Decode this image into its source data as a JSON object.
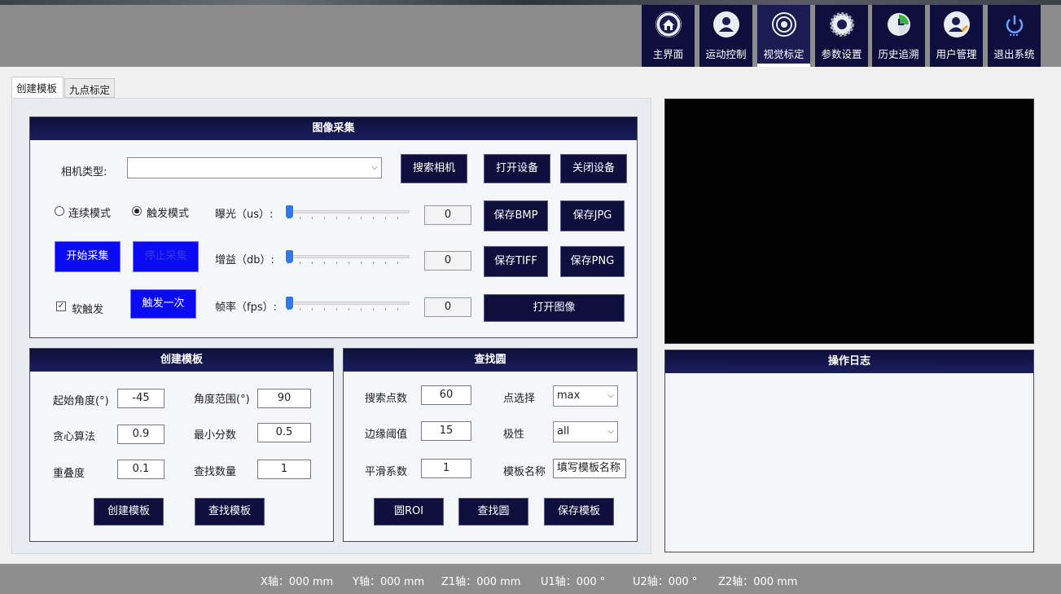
{
  "nav": {
    "items": [
      {
        "label": "主界面",
        "icon": "home-icon"
      },
      {
        "label": "运动控制",
        "icon": "user-icon"
      },
      {
        "label": "视觉标定",
        "icon": "target-icon"
      },
      {
        "label": "参数设置",
        "icon": "gear-icon"
      },
      {
        "label": "历史追溯",
        "icon": "history-icon"
      },
      {
        "label": "用户管理",
        "icon": "user-edit-icon"
      },
      {
        "label": "退出系统",
        "icon": "power-icon"
      }
    ],
    "active_index": 2
  },
  "tabs": [
    "创建模板",
    "九点标定"
  ],
  "capture": {
    "title": "图像采集",
    "camera_type_label": "相机类型:",
    "camera_type_value": "",
    "search_camera": "搜索相机",
    "open_device": "打开设备",
    "close_device": "关闭设备",
    "mode_continuous": "连续模式",
    "mode_trigger": "触发模式",
    "selected_mode": "trigger",
    "exposure_label": "曝光（us）:",
    "exposure_value": "0",
    "gain_label": "增益（db）:",
    "gain_value": "0",
    "fps_label": "帧率（fps）:",
    "fps_value": "0",
    "save_bmp": "保存BMP",
    "save_jpg": "保存JPG",
    "save_tiff": "保存TIFF",
    "save_png": "保存PNG",
    "start_capture": "开始采集",
    "stop_capture": "停止采集",
    "soft_trigger": "软触发",
    "soft_trigger_checked": true,
    "trigger_once": "触发一次",
    "open_image": "打开图像"
  },
  "create_template": {
    "title": "创建模板",
    "start_angle_label": "起始角度(°)",
    "start_angle_value": "-45",
    "angle_range_label": "角度范围(°)",
    "angle_range_value": "90",
    "greedy_label": "贪心算法",
    "greedy_value": "0.9",
    "min_score_label": "最小分数",
    "min_score_value": "0.5",
    "overlap_label": "重叠度",
    "overlap_value": "0.1",
    "find_count_label": "查找数量",
    "find_count_value": "1",
    "create_button": "创建模板",
    "find_button": "查找模板"
  },
  "find_circle": {
    "title": "查找圆",
    "search_points_label": "搜索点数",
    "search_points_value": "60",
    "point_select_label": "点选择",
    "point_select_value": "max",
    "edge_threshold_label": "边缘阈值",
    "edge_threshold_value": "15",
    "polarity_label": "极性",
    "polarity_value": "all",
    "smooth_label": "平滑系数",
    "smooth_value": "1",
    "template_name_label": "模板名称",
    "template_name_value": "填写模板名称",
    "circle_roi_button": "圆ROI",
    "find_circle_button": "查找圆",
    "save_template_button": "保存模板"
  },
  "log": {
    "title": "操作日志"
  },
  "status": [
    {
      "label": "X轴：",
      "value": "000 mm"
    },
    {
      "label": "Y轴：",
      "value": "000 mm"
    },
    {
      "label": "Z1轴：",
      "value": "000 mm"
    },
    {
      "label": "U1轴：",
      "value": "000 °"
    },
    {
      "label": "U2轴：",
      "value": "000 °"
    },
    {
      "label": "Z2轴：",
      "value": "000 mm"
    }
  ],
  "colors": {
    "nav_bg": "#0e0f3c",
    "panel_title": "#0d0f3a",
    "blue_button": "#0a0af5",
    "header_grey": "#8c8c8c"
  }
}
